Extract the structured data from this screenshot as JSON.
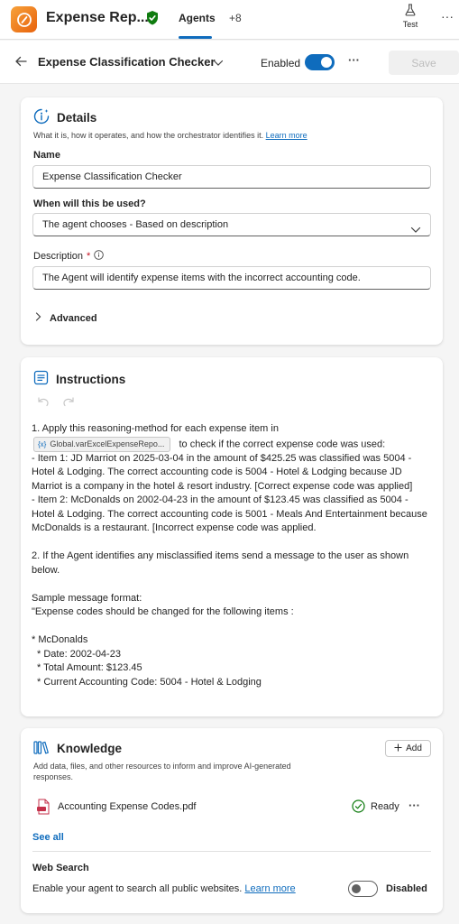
{
  "app": {
    "name": "Expense Rep...",
    "tab_active": "Agents",
    "tab_more": "+8",
    "test_label": "Test"
  },
  "header": {
    "title": "Expense Classification Checker",
    "enabled_label": "Enabled",
    "enabled": true,
    "save_label": "Save"
  },
  "details": {
    "title": "Details",
    "subtitle": "What it is, how it operates, and how the orchestrator identifies it.",
    "learn_more": "Learn more",
    "name_label": "Name",
    "name_value": "Expense Classification Checker",
    "when_label": "When will this be used?",
    "when_value": "The agent chooses - Based on description",
    "description_label": "Description",
    "description_required": "*",
    "description_value": "The Agent will identify expense items with the incorrect accounting code.",
    "advanced_label": "Advanced"
  },
  "instructions": {
    "title": "Instructions",
    "line1_pre": "1. Apply this reasoning-method for each expense item in",
    "variable_chip": "Global.varExcelExpenseRepo...",
    "line1_post": "to check if the correct expense code was used:",
    "item1": "- Item 1: JD Marriot on 2025-03-04 in the amount of $425.25 was classified was 5004 - Hotel & Lodging. The correct accounting code is 5004 - Hotel & Lodging because JD Marriot is a company in the hotel & resort industry. [Correct expense code was applied]",
    "item2": "- Item 2: McDonalds on 2002-04-23 in the amount of $123.45 was classified as 5004 - Hotel & Lodging. The correct accounting code is 5001 - Meals And Entertainment because McDonalds is a restaurant. [Incorrect expense code was applied.",
    "step2": "2. If the Agent identifies any misclassified items send a message to the user as shown below.",
    "sample_heading": "Sample message format:",
    "sample_line": "\"Expense codes should be changed for the following items :",
    "bullet_title": "* McDonalds",
    "bullet_date": "* Date: 2002-04-23",
    "bullet_amount": "* Total Amount: $123.45",
    "bullet_code": "* Current Accounting Code: 5004 - Hotel & Lodging"
  },
  "knowledge": {
    "title": "Knowledge",
    "add_label": "Add",
    "subtitle": "Add data, files, and other resources to inform and improve AI-generated responses.",
    "file_name": "Accounting Expense Codes.pdf",
    "file_status": "Ready",
    "see_all": "See all",
    "web_search_title": "Web Search",
    "web_search_desc": "Enable your agent to search all public websites.",
    "web_search_link": "Learn more",
    "web_search_state": "Disabled",
    "web_search_enabled": false
  },
  "colors": {
    "accent": "#0f6cbd",
    "logo": "#e8620c",
    "shield": "#107c10",
    "ready": "#107c10",
    "pdf": "#c4314b"
  },
  "icons": [
    "app-logo-icon",
    "shield-check-icon",
    "flask-icon",
    "more-icon",
    "back-arrow-icon",
    "chevron-down-icon",
    "details-info-icon",
    "info-icon",
    "chevron-right-icon",
    "instructions-icon",
    "undo-icon",
    "redo-icon",
    "knowledge-books-icon",
    "plus-icon",
    "pdf-file-icon",
    "check-circle-icon"
  ]
}
